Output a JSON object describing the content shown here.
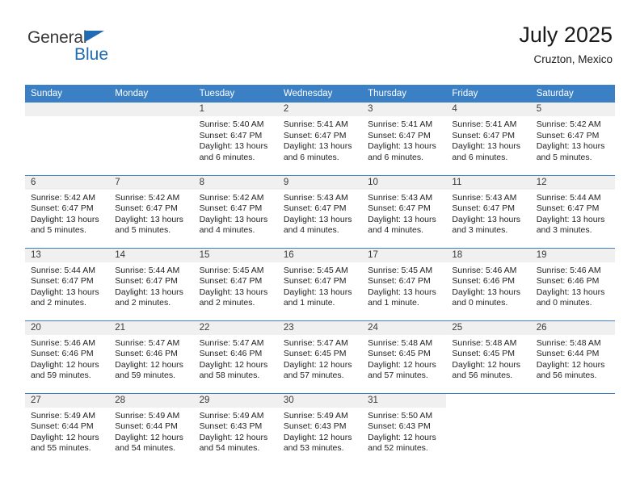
{
  "brand": {
    "name_part1": "General",
    "name_part2": "Blue",
    "accent_color": "#1f6cb4",
    "flag_icon": "triangle-flag-icon"
  },
  "header": {
    "title": "July 2025",
    "location": "Cruzton, Mexico"
  },
  "calendar": {
    "header_bg": "#3b7fc4",
    "daybar_bg": "#f0f0f0",
    "weekdays": [
      "Sunday",
      "Monday",
      "Tuesday",
      "Wednesday",
      "Thursday",
      "Friday",
      "Saturday"
    ],
    "weeks": [
      [
        {
          "date": "",
          "blank": true,
          "sunrise": "",
          "sunset": "",
          "daylight_line1": "",
          "daylight_line2": ""
        },
        {
          "date": "",
          "blank": true,
          "sunrise": "",
          "sunset": "",
          "daylight_line1": "",
          "daylight_line2": ""
        },
        {
          "date": "1",
          "sunrise": "Sunrise: 5:40 AM",
          "sunset": "Sunset: 6:47 PM",
          "daylight_line1": "Daylight: 13 hours",
          "daylight_line2": "and 6 minutes."
        },
        {
          "date": "2",
          "sunrise": "Sunrise: 5:41 AM",
          "sunset": "Sunset: 6:47 PM",
          "daylight_line1": "Daylight: 13 hours",
          "daylight_line2": "and 6 minutes."
        },
        {
          "date": "3",
          "sunrise": "Sunrise: 5:41 AM",
          "sunset": "Sunset: 6:47 PM",
          "daylight_line1": "Daylight: 13 hours",
          "daylight_line2": "and 6 minutes."
        },
        {
          "date": "4",
          "sunrise": "Sunrise: 5:41 AM",
          "sunset": "Sunset: 6:47 PM",
          "daylight_line1": "Daylight: 13 hours",
          "daylight_line2": "and 6 minutes."
        },
        {
          "date": "5",
          "sunrise": "Sunrise: 5:42 AM",
          "sunset": "Sunset: 6:47 PM",
          "daylight_line1": "Daylight: 13 hours",
          "daylight_line2": "and 5 minutes."
        }
      ],
      [
        {
          "date": "6",
          "sunrise": "Sunrise: 5:42 AM",
          "sunset": "Sunset: 6:47 PM",
          "daylight_line1": "Daylight: 13 hours",
          "daylight_line2": "and 5 minutes."
        },
        {
          "date": "7",
          "sunrise": "Sunrise: 5:42 AM",
          "sunset": "Sunset: 6:47 PM",
          "daylight_line1": "Daylight: 13 hours",
          "daylight_line2": "and 5 minutes."
        },
        {
          "date": "8",
          "sunrise": "Sunrise: 5:42 AM",
          "sunset": "Sunset: 6:47 PM",
          "daylight_line1": "Daylight: 13 hours",
          "daylight_line2": "and 4 minutes."
        },
        {
          "date": "9",
          "sunrise": "Sunrise: 5:43 AM",
          "sunset": "Sunset: 6:47 PM",
          "daylight_line1": "Daylight: 13 hours",
          "daylight_line2": "and 4 minutes."
        },
        {
          "date": "10",
          "sunrise": "Sunrise: 5:43 AM",
          "sunset": "Sunset: 6:47 PM",
          "daylight_line1": "Daylight: 13 hours",
          "daylight_line2": "and 4 minutes."
        },
        {
          "date": "11",
          "sunrise": "Sunrise: 5:43 AM",
          "sunset": "Sunset: 6:47 PM",
          "daylight_line1": "Daylight: 13 hours",
          "daylight_line2": "and 3 minutes."
        },
        {
          "date": "12",
          "sunrise": "Sunrise: 5:44 AM",
          "sunset": "Sunset: 6:47 PM",
          "daylight_line1": "Daylight: 13 hours",
          "daylight_line2": "and 3 minutes."
        }
      ],
      [
        {
          "date": "13",
          "sunrise": "Sunrise: 5:44 AM",
          "sunset": "Sunset: 6:47 PM",
          "daylight_line1": "Daylight: 13 hours",
          "daylight_line2": "and 2 minutes."
        },
        {
          "date": "14",
          "sunrise": "Sunrise: 5:44 AM",
          "sunset": "Sunset: 6:47 PM",
          "daylight_line1": "Daylight: 13 hours",
          "daylight_line2": "and 2 minutes."
        },
        {
          "date": "15",
          "sunrise": "Sunrise: 5:45 AM",
          "sunset": "Sunset: 6:47 PM",
          "daylight_line1": "Daylight: 13 hours",
          "daylight_line2": "and 2 minutes."
        },
        {
          "date": "16",
          "sunrise": "Sunrise: 5:45 AM",
          "sunset": "Sunset: 6:47 PM",
          "daylight_line1": "Daylight: 13 hours",
          "daylight_line2": "and 1 minute."
        },
        {
          "date": "17",
          "sunrise": "Sunrise: 5:45 AM",
          "sunset": "Sunset: 6:47 PM",
          "daylight_line1": "Daylight: 13 hours",
          "daylight_line2": "and 1 minute."
        },
        {
          "date": "18",
          "sunrise": "Sunrise: 5:46 AM",
          "sunset": "Sunset: 6:46 PM",
          "daylight_line1": "Daylight: 13 hours",
          "daylight_line2": "and 0 minutes."
        },
        {
          "date": "19",
          "sunrise": "Sunrise: 5:46 AM",
          "sunset": "Sunset: 6:46 PM",
          "daylight_line1": "Daylight: 13 hours",
          "daylight_line2": "and 0 minutes."
        }
      ],
      [
        {
          "date": "20",
          "sunrise": "Sunrise: 5:46 AM",
          "sunset": "Sunset: 6:46 PM",
          "daylight_line1": "Daylight: 12 hours",
          "daylight_line2": "and 59 minutes."
        },
        {
          "date": "21",
          "sunrise": "Sunrise: 5:47 AM",
          "sunset": "Sunset: 6:46 PM",
          "daylight_line1": "Daylight: 12 hours",
          "daylight_line2": "and 59 minutes."
        },
        {
          "date": "22",
          "sunrise": "Sunrise: 5:47 AM",
          "sunset": "Sunset: 6:46 PM",
          "daylight_line1": "Daylight: 12 hours",
          "daylight_line2": "and 58 minutes."
        },
        {
          "date": "23",
          "sunrise": "Sunrise: 5:47 AM",
          "sunset": "Sunset: 6:45 PM",
          "daylight_line1": "Daylight: 12 hours",
          "daylight_line2": "and 57 minutes."
        },
        {
          "date": "24",
          "sunrise": "Sunrise: 5:48 AM",
          "sunset": "Sunset: 6:45 PM",
          "daylight_line1": "Daylight: 12 hours",
          "daylight_line2": "and 57 minutes."
        },
        {
          "date": "25",
          "sunrise": "Sunrise: 5:48 AM",
          "sunset": "Sunset: 6:45 PM",
          "daylight_line1": "Daylight: 12 hours",
          "daylight_line2": "and 56 minutes."
        },
        {
          "date": "26",
          "sunrise": "Sunrise: 5:48 AM",
          "sunset": "Sunset: 6:44 PM",
          "daylight_line1": "Daylight: 12 hours",
          "daylight_line2": "and 56 minutes."
        }
      ],
      [
        {
          "date": "27",
          "sunrise": "Sunrise: 5:49 AM",
          "sunset": "Sunset: 6:44 PM",
          "daylight_line1": "Daylight: 12 hours",
          "daylight_line2": "and 55 minutes."
        },
        {
          "date": "28",
          "sunrise": "Sunrise: 5:49 AM",
          "sunset": "Sunset: 6:44 PM",
          "daylight_line1": "Daylight: 12 hours",
          "daylight_line2": "and 54 minutes."
        },
        {
          "date": "29",
          "sunrise": "Sunrise: 5:49 AM",
          "sunset": "Sunset: 6:43 PM",
          "daylight_line1": "Daylight: 12 hours",
          "daylight_line2": "and 54 minutes."
        },
        {
          "date": "30",
          "sunrise": "Sunrise: 5:49 AM",
          "sunset": "Sunset: 6:43 PM",
          "daylight_line1": "Daylight: 12 hours",
          "daylight_line2": "and 53 minutes."
        },
        {
          "date": "31",
          "sunrise": "Sunrise: 5:50 AM",
          "sunset": "Sunset: 6:43 PM",
          "daylight_line1": "Daylight: 12 hours",
          "daylight_line2": "and 52 minutes."
        },
        {
          "date": "",
          "empty": true,
          "sunrise": "",
          "sunset": "",
          "daylight_line1": "",
          "daylight_line2": ""
        },
        {
          "date": "",
          "empty": true,
          "sunrise": "",
          "sunset": "",
          "daylight_line1": "",
          "daylight_line2": ""
        }
      ]
    ]
  }
}
